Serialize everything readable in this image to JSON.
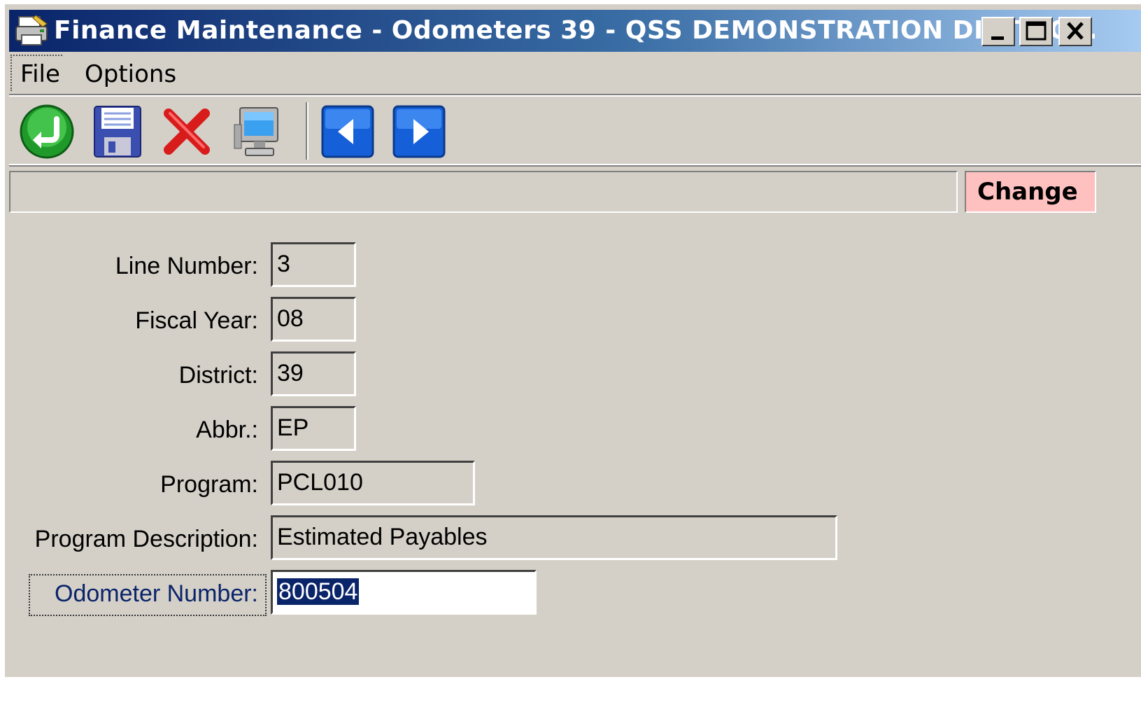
{
  "window": {
    "title": "Finance Maintenance - Odometers 39 - QSS DEMONSTRATION DISTRIC..."
  },
  "menu": {
    "file_label": "File",
    "options_label": "Options"
  },
  "toolbar": {
    "buttons": [
      {
        "name": "accept",
        "icon": "green-check-return-icon"
      },
      {
        "name": "save",
        "icon": "floppy-disk-icon"
      },
      {
        "name": "delete",
        "icon": "red-x-icon"
      },
      {
        "name": "computer",
        "icon": "computer-monitor-icon"
      },
      {
        "name": "previous",
        "icon": "blue-left-arrow-icon"
      },
      {
        "name": "next",
        "icon": "blue-right-arrow-icon"
      }
    ]
  },
  "status": {
    "message": "",
    "mode": "Change",
    "mode_color": "#ffc0c0"
  },
  "form": {
    "line_number": {
      "label": "Line Number:",
      "value": "3"
    },
    "fiscal_year": {
      "label": "Fiscal Year:",
      "value": "08"
    },
    "district": {
      "label": "District:",
      "value": "39"
    },
    "abbr": {
      "label": "Abbr.:",
      "value": "EP"
    },
    "program": {
      "label": "Program:",
      "value": "PCL010"
    },
    "program_description": {
      "label": "Program Description:",
      "value": "Estimated Payables"
    },
    "odometer_number": {
      "label": "Odometer Number:",
      "value": "800504"
    }
  },
  "colors": {
    "title_bar_start": "#0a246a",
    "title_bar_end": "#a6caf0",
    "window_face": "#d4d0c8",
    "selection": "#0a246a"
  }
}
